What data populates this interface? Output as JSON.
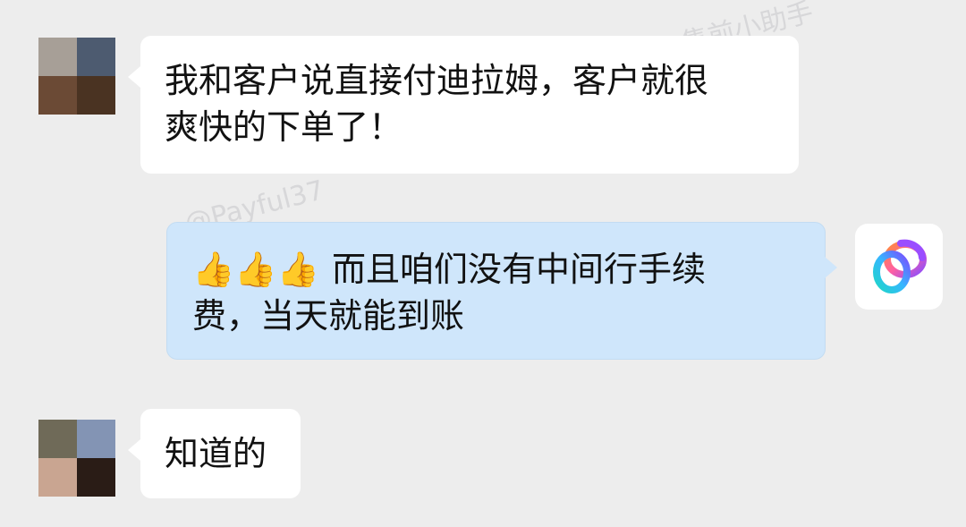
{
  "watermarks": {
    "top_right": "售前小助手",
    "middle": "@Payful37"
  },
  "messages": [
    {
      "side": "left",
      "text_line1": "我和客户说直接付迪拉姆，客户就很",
      "text_line2": "爽快的下单了！",
      "avatar_colors": [
        "#a79f97",
        "#4d5b70",
        "#6b4a35",
        "#4a3322"
      ]
    },
    {
      "side": "right",
      "emoji": "👍👍👍",
      "text_line1": "而且咱们没有中间行手续",
      "text_line2": "费，当天就能到账",
      "avatar_icon": "payful-logo-icon"
    },
    {
      "side": "left",
      "text_line1": "知道的",
      "avatar_colors": [
        "#6f6a58",
        "#8394b4",
        "#c9a591",
        "#2a1c16"
      ]
    }
  ],
  "colors": {
    "background": "#ededed",
    "left_bubble": "#ffffff",
    "right_bubble": "#cfe6fb"
  }
}
